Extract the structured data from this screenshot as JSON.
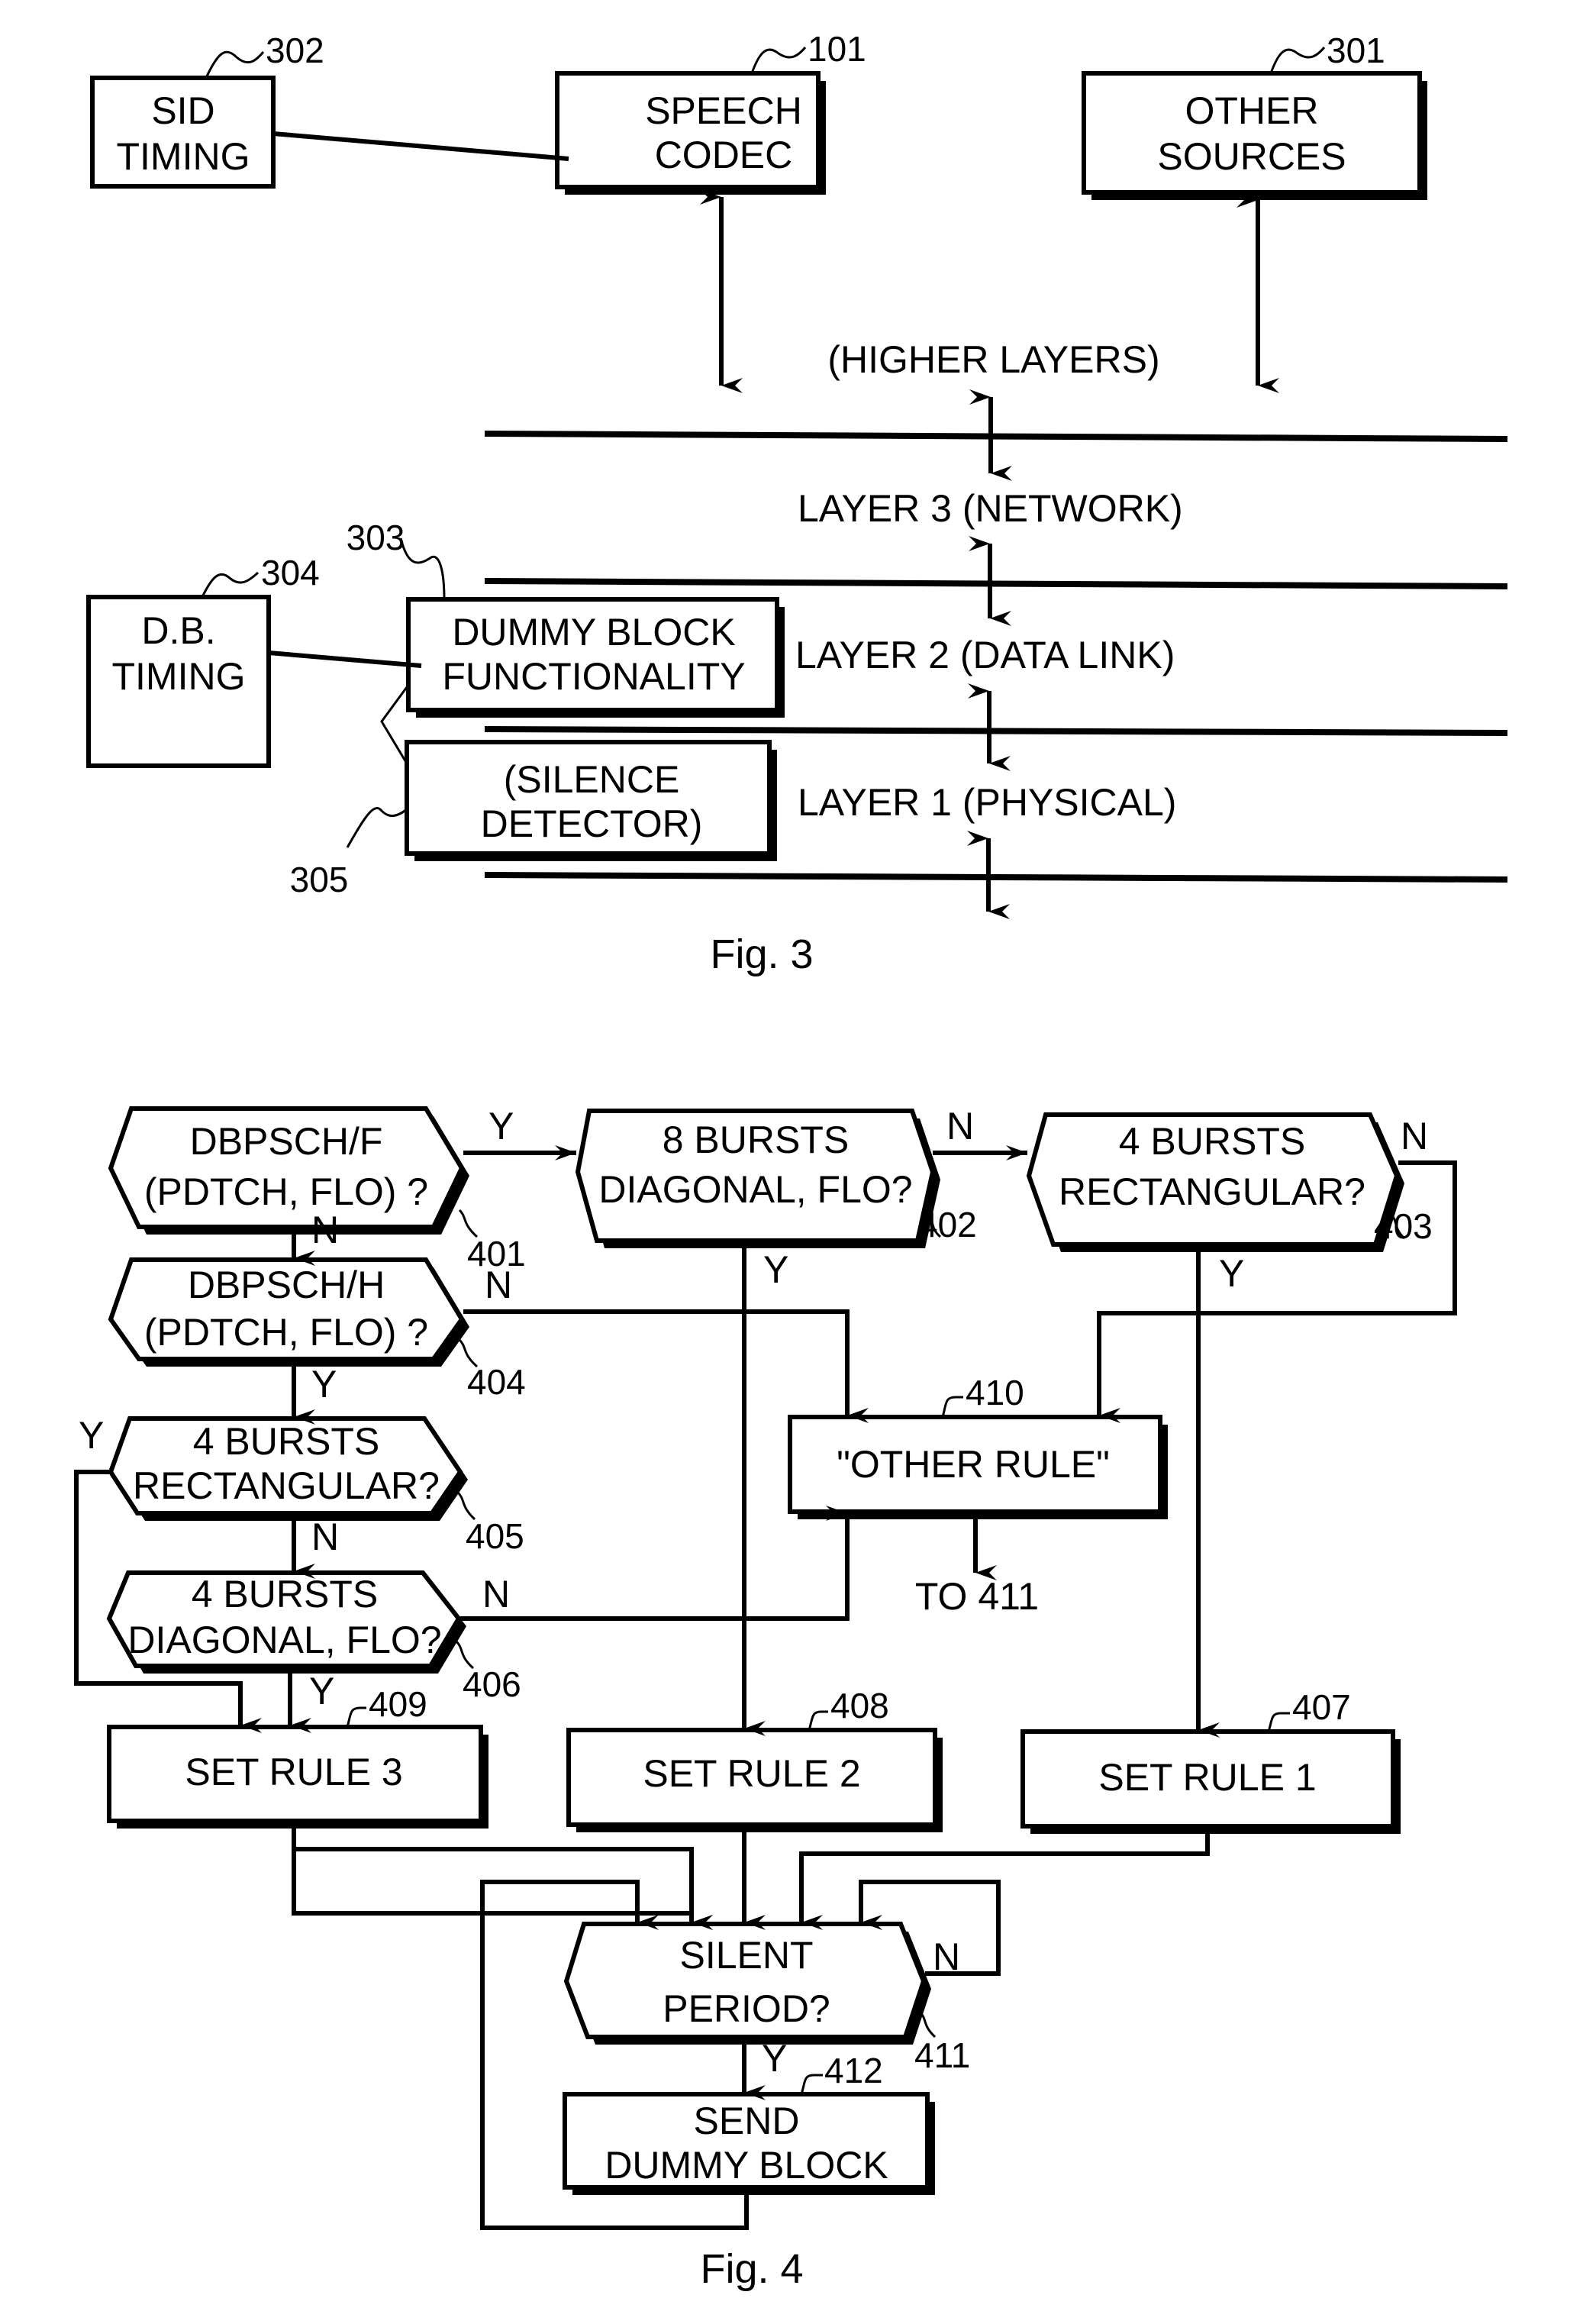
{
  "fig3": {
    "caption": "Fig. 3",
    "blocks": {
      "sid_timing": {
        "ref": "302",
        "lines": [
          "SID",
          "TIMING"
        ]
      },
      "speech_codec": {
        "ref": "101",
        "lines": [
          "SPEECH",
          "CODEC"
        ]
      },
      "other_sources": {
        "ref": "301",
        "lines": [
          "OTHER",
          "SOURCES"
        ]
      },
      "db_timing": {
        "ref": "304",
        "lines": [
          "D.B.",
          "TIMING"
        ]
      },
      "dummy_block": {
        "ref": "303",
        "lines": [
          "DUMMY BLOCK",
          "FUNCTIONALITY"
        ]
      },
      "silence_detector": {
        "ref": "305",
        "lines": [
          "(SILENCE",
          "DETECTOR)"
        ]
      }
    },
    "layers": [
      "(HIGHER LAYERS)",
      "LAYER 3 (NETWORK)",
      "LAYER 2 (DATA LINK)",
      "LAYER 1 (PHYSICAL)"
    ]
  },
  "fig4": {
    "caption": "Fig. 4",
    "decisions": {
      "d401": {
        "ref": "401",
        "lines": [
          "DBPSCH/F",
          "(PDTCH, FLO) ?"
        ]
      },
      "d402": {
        "ref": "402",
        "lines": [
          "8 BURSTS",
          "DIAGONAL, FLO?"
        ]
      },
      "d403": {
        "ref": "403",
        "lines": [
          "4 BURSTS",
          "RECTANGULAR?"
        ]
      },
      "d404": {
        "ref": "404",
        "lines": [
          "DBPSCH/H",
          "(PDTCH, FLO) ?"
        ]
      },
      "d405": {
        "ref": "405",
        "lines": [
          "4 BURSTS",
          "RECTANGULAR?"
        ]
      },
      "d406": {
        "ref": "406",
        "lines": [
          "4 BURSTS",
          "DIAGONAL, FLO?"
        ]
      },
      "d411": {
        "ref": "411",
        "lines": [
          "SILENT",
          "PERIOD?"
        ]
      }
    },
    "processes": {
      "p407": {
        "ref": "407",
        "lines": [
          "SET RULE 1"
        ]
      },
      "p408": {
        "ref": "408",
        "lines": [
          "SET RULE 2"
        ]
      },
      "p409": {
        "ref": "409",
        "lines": [
          "SET RULE 3"
        ]
      },
      "p410": {
        "ref": "410",
        "lines": [
          "\"OTHER RULE\""
        ]
      },
      "p412": {
        "ref": "412",
        "lines": [
          "SEND",
          "DUMMY BLOCK"
        ]
      }
    },
    "connector_text": "TO 411",
    "edge_labels": {
      "yes": "Y",
      "no": "N"
    }
  }
}
